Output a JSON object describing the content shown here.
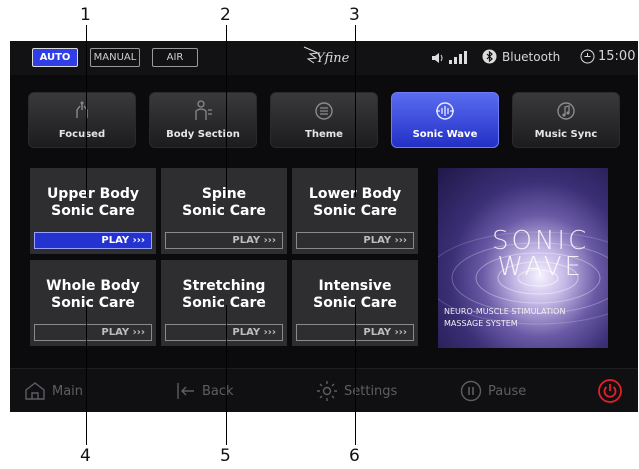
{
  "callouts": [
    "1",
    "2",
    "3",
    "4",
    "5",
    "6"
  ],
  "status_bar": {
    "modes": [
      "AUTO",
      "MANUAL",
      "AIR"
    ],
    "active_mode": "AUTO",
    "logo": "Yfine",
    "bluetooth_label": "Bluetooth",
    "time": "15:00"
  },
  "tabs": [
    {
      "label": "Focused",
      "icon": "hands-icon"
    },
    {
      "label": "Body Section",
      "icon": "body-section-icon"
    },
    {
      "label": "Theme",
      "icon": "theme-icon"
    },
    {
      "label": "Sonic Wave",
      "icon": "sonic-wave-icon",
      "active": true
    },
    {
      "label": "Music Sync",
      "icon": "music-note-icon"
    }
  ],
  "programs": [
    {
      "line1": "Upper Body",
      "line2": "Sonic Care",
      "play": "PLAY ›››",
      "active": true
    },
    {
      "line1": "Spine",
      "line2": "Sonic Care",
      "play": "PLAY ›››"
    },
    {
      "line1": "Lower Body",
      "line2": "Sonic Care",
      "play": "PLAY ›››"
    },
    {
      "line1": "Whole Body",
      "line2": "Sonic Care",
      "play": "PLAY ›››"
    },
    {
      "line1": "Stretching",
      "line2": "Sonic Care",
      "play": "PLAY ›››"
    },
    {
      "line1": "Intensive",
      "line2": "Sonic Care",
      "play": "PLAY ›››"
    }
  ],
  "sonic_image": {
    "title_line1": "SONIC",
    "title_line2": "WAVE",
    "subtitle_line1": "NEURO-MUSCLE STIMULATION",
    "subtitle_line2": "MASSAGE SYSTEM"
  },
  "bottom_bar": {
    "main": "Main",
    "back": "Back",
    "settings": "Settings",
    "pause": "Pause"
  },
  "colors": {
    "accent": "#2432d0",
    "tab_active": "#3f4fe0",
    "power": "#e0202a"
  }
}
